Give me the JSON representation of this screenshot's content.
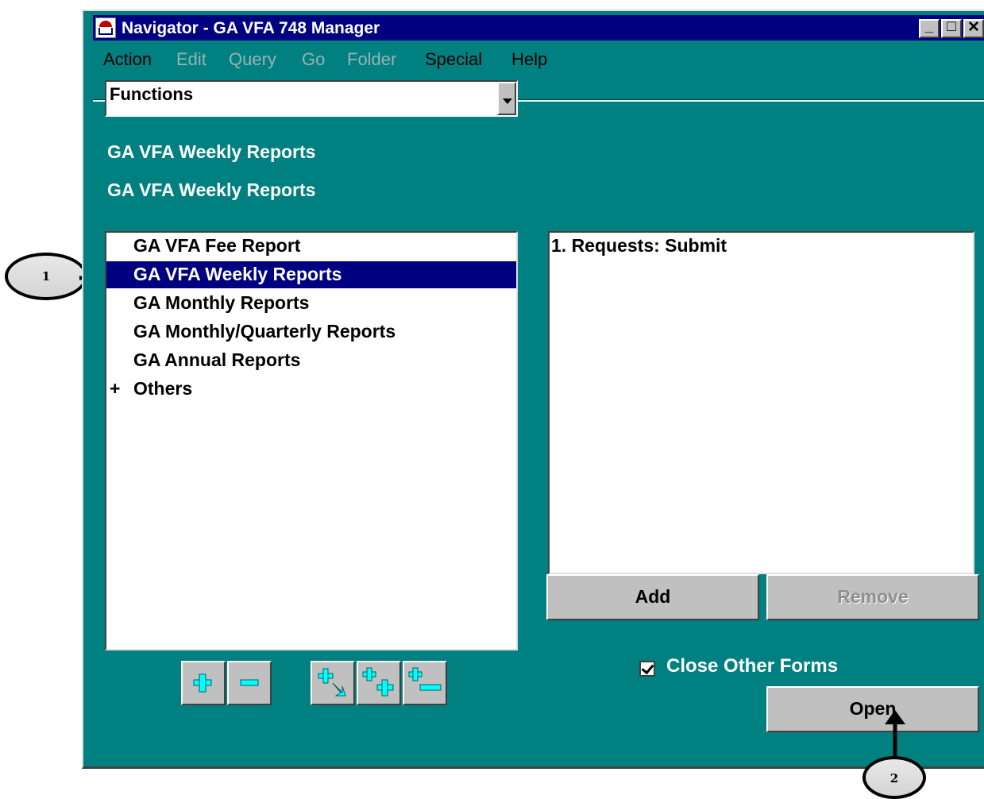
{
  "window": {
    "title": "Navigator - GA VFA 748 Manager",
    "minimize_glyph": "_",
    "maximize_glyph": "□",
    "close_glyph": "✕"
  },
  "menu": {
    "items": [
      {
        "label": "Action",
        "enabled": true,
        "underline": "A"
      },
      {
        "label": "Edit",
        "enabled": false
      },
      {
        "label": "Query",
        "enabled": false
      },
      {
        "label": "Go",
        "enabled": false
      },
      {
        "label": "Folder",
        "enabled": false
      },
      {
        "label": "Special",
        "enabled": true,
        "underline": "S"
      },
      {
        "label": "Help",
        "enabled": true,
        "underline": "H"
      }
    ]
  },
  "functions_select": {
    "value": "Functions"
  },
  "headers": {
    "line1": "GA VFA Weekly Reports",
    "line2": "GA VFA Weekly Reports"
  },
  "tree": {
    "items": [
      {
        "label": "GA VFA Fee Report",
        "selected": false,
        "expander": ""
      },
      {
        "label": "GA VFA Weekly Reports",
        "selected": true,
        "expander": ""
      },
      {
        "label": "GA Monthly Reports",
        "selected": false,
        "expander": ""
      },
      {
        "label": "GA Monthly/Quarterly Reports",
        "selected": false,
        "expander": ""
      },
      {
        "label": "GA Annual Reports",
        "selected": false,
        "expander": ""
      },
      {
        "label": "Others",
        "selected": false,
        "expander": "+"
      }
    ]
  },
  "documents_list": {
    "items": [
      "1. Requests: Submit"
    ]
  },
  "buttons": {
    "add": "Add",
    "remove": "Remove",
    "open": "Open"
  },
  "checkbox": {
    "label": "Close Other Forms",
    "checked": true
  },
  "callouts": {
    "one": "1",
    "two": "2"
  },
  "colors": {
    "window_bg": "#008080",
    "titlebar": "#000080",
    "selection": "#000080",
    "icon_cyan": "#00ffff"
  }
}
